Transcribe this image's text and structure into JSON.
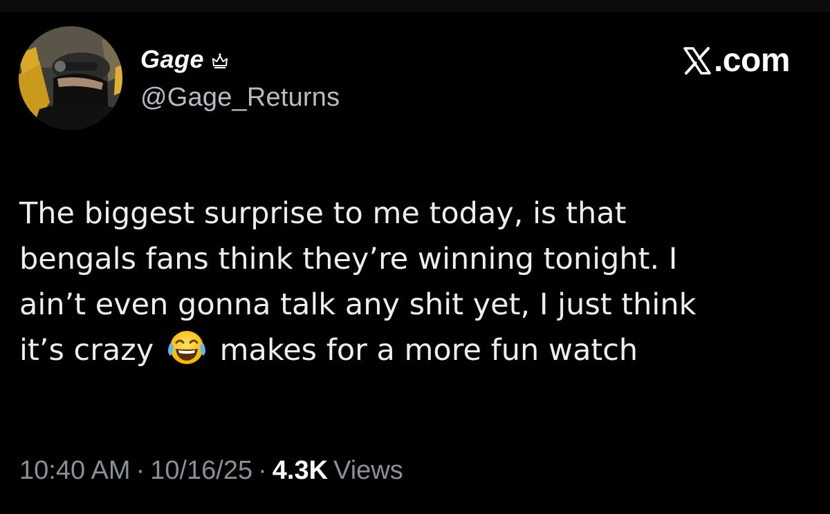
{
  "post": {
    "author": {
      "display_name": "Gage",
      "handle": "@Gage_Returns",
      "badge_icon": "crown-icon",
      "avatar_icon": "profile-photo"
    },
    "brand": {
      "icon": "x-logo-icon",
      "label": ".com"
    },
    "text_lines": [
      "The biggest surprise to me today, is that",
      "bengals fans think they’re winning tonight. I",
      "ain’t even gonna talk any shit yet, I just think"
    ],
    "last_line": {
      "before": "it’s crazy",
      "emoji": "face-with-tears-of-joy-icon",
      "after": "makes for a more fun watch"
    },
    "meta": {
      "time": "10:40 AM",
      "date": "10/16/25",
      "views_count": "4.3K",
      "views_label": "Views",
      "separator": "·"
    }
  },
  "colors": {
    "background": "#000000",
    "text_primary": "#eeeeee",
    "text_secondary": "#8b9096",
    "views_count": "#ffffff"
  }
}
